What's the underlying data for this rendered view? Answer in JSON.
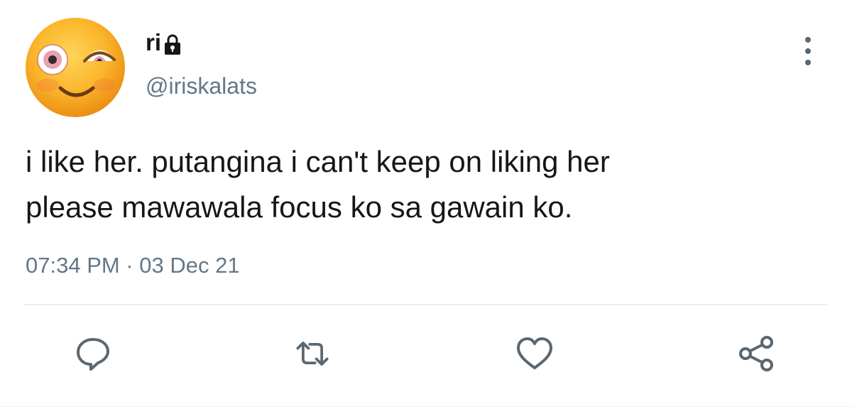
{
  "author": {
    "display_name": "ri",
    "handle": "@iriskalats",
    "avatar": "flushed-face-emoji",
    "protected_icon": "lock-icon"
  },
  "tweet": {
    "lines": [
      "i like her. putangina i can't keep on liking her",
      "please mawawala focus ko sa gawain ko."
    ],
    "timestamp": "07:34 PM · 03 Dec 21"
  },
  "actions": {
    "more": "more-options-icon",
    "reply": "reply-icon",
    "retweet": "retweet-icon",
    "like": "heart-icon",
    "share": "share-icon"
  },
  "colors": {
    "text": "#14171a",
    "secondary": "#657786",
    "icon": "#5b6770",
    "divider": "#e6ecf0"
  }
}
